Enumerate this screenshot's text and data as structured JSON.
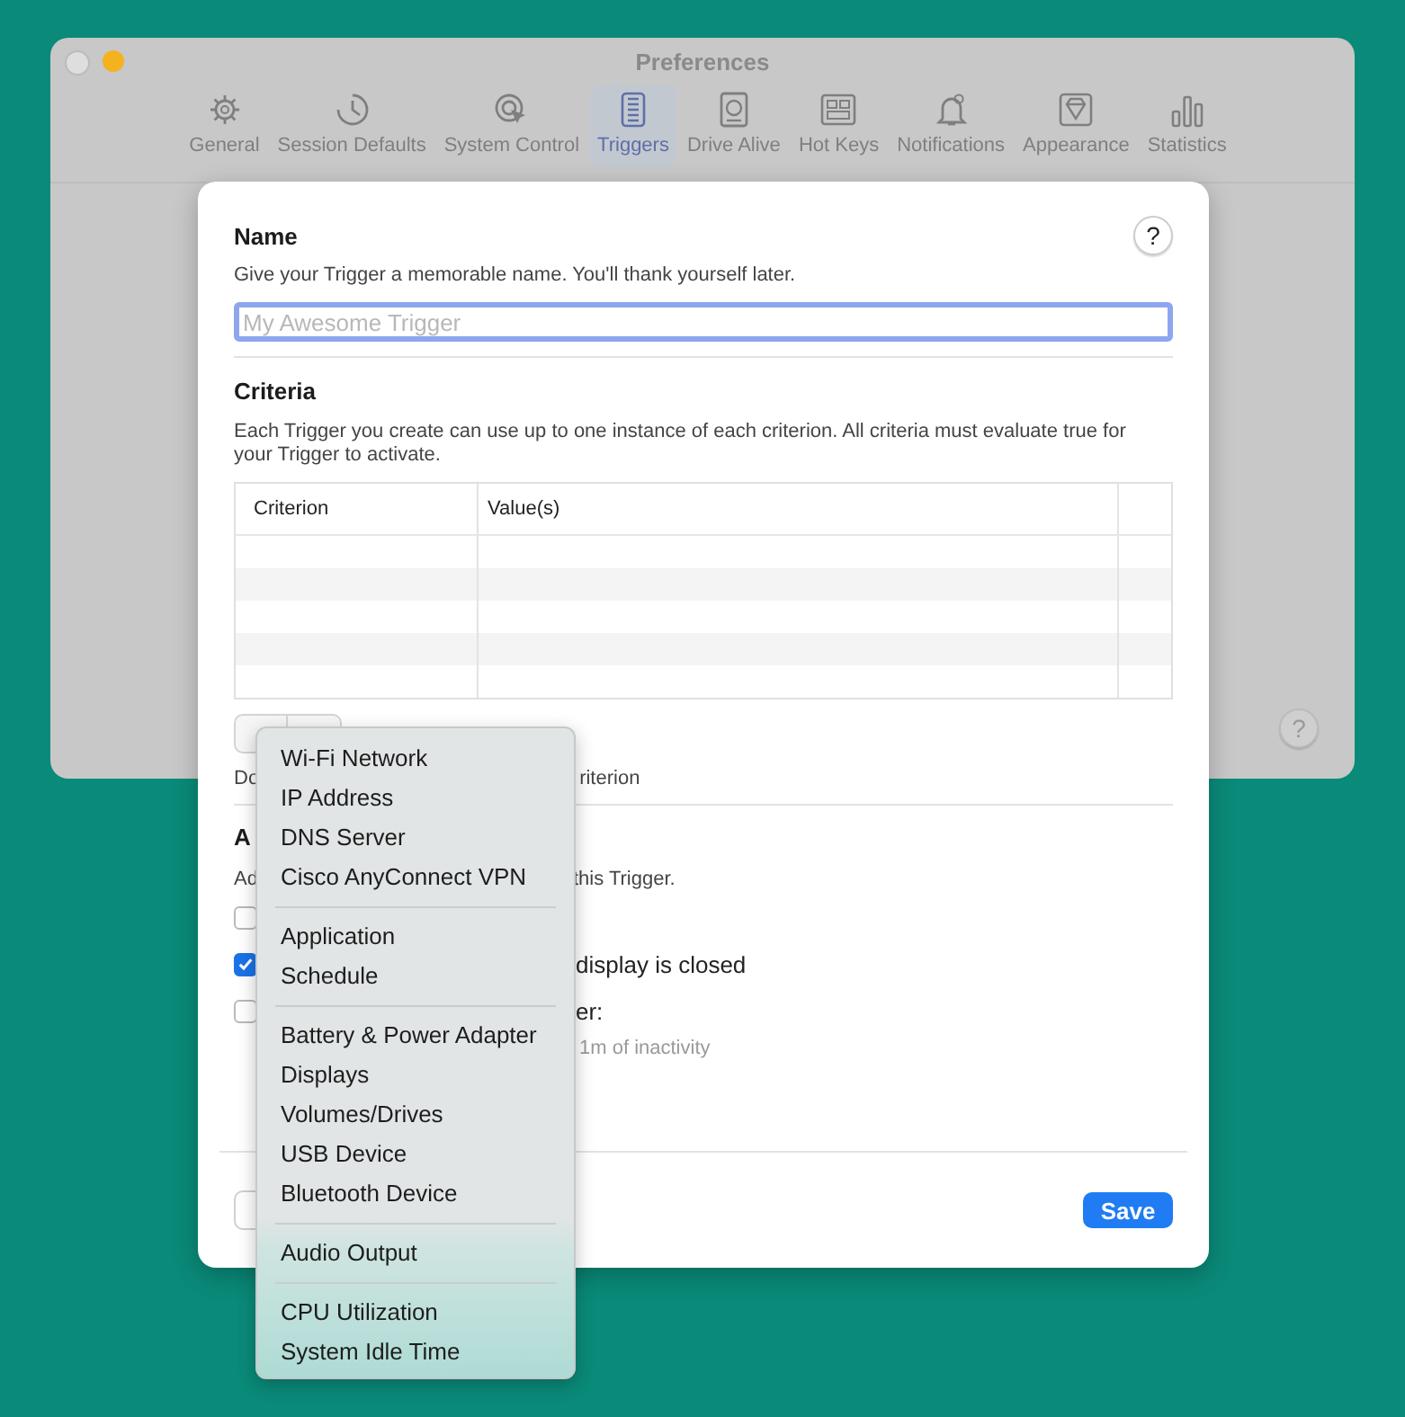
{
  "window": {
    "title": "Preferences",
    "controls": [
      {
        "kind": "close"
      },
      {
        "kind": "minimize"
      }
    ]
  },
  "toolbar": [
    {
      "label": "General",
      "selected": false
    },
    {
      "label": "Session Defaults",
      "selected": false
    },
    {
      "label": "System Control",
      "selected": false
    },
    {
      "label": "Triggers",
      "selected": true
    },
    {
      "label": "Drive Alive",
      "selected": false
    },
    {
      "label": "Hot Keys",
      "selected": false
    },
    {
      "label": "Notifications",
      "selected": false
    },
    {
      "label": "Appearance",
      "selected": false
    },
    {
      "label": "Statistics",
      "selected": false
    }
  ],
  "sheet": {
    "help": "?",
    "name": {
      "heading": "Name",
      "description": "Give your Trigger a memorable name. You'll thank yourself later.",
      "placeholder": "My Awesome Trigger"
    },
    "criteria": {
      "heading": "Criteria",
      "description": "Each Trigger you create can use up to one instance of each criterion. All criteria must evaluate true for your Trigger to activate.",
      "columns": [
        "Criterion",
        "Value(s)"
      ],
      "hint_start": "Do",
      "hint_end": "riterion"
    },
    "actions": {
      "heading": "A",
      "description_start": "Ad",
      "description_end": "this Trigger.",
      "options": [
        {
          "checked": false
        },
        {
          "checked": true,
          "text": "display is closed"
        },
        {
          "checked": false,
          "text": "er:"
        }
      ],
      "note": "1m of inactivity"
    },
    "save": "Save"
  },
  "window_help": "?",
  "menu": {
    "sections": [
      {
        "items": [
          "Wi-Fi Network",
          "IP Address",
          "DNS Server",
          "Cisco AnyConnect VPN"
        ]
      },
      {
        "items": [
          "Application",
          "Schedule"
        ]
      },
      {
        "items": [
          "Battery & Power Adapter",
          "Displays",
          "Volumes/Drives",
          "USB Device",
          "Bluetooth Device"
        ]
      },
      {
        "items": [
          "Audio Output"
        ]
      },
      {
        "items": [
          "CPU Utilization",
          "System Idle Time"
        ]
      }
    ]
  }
}
